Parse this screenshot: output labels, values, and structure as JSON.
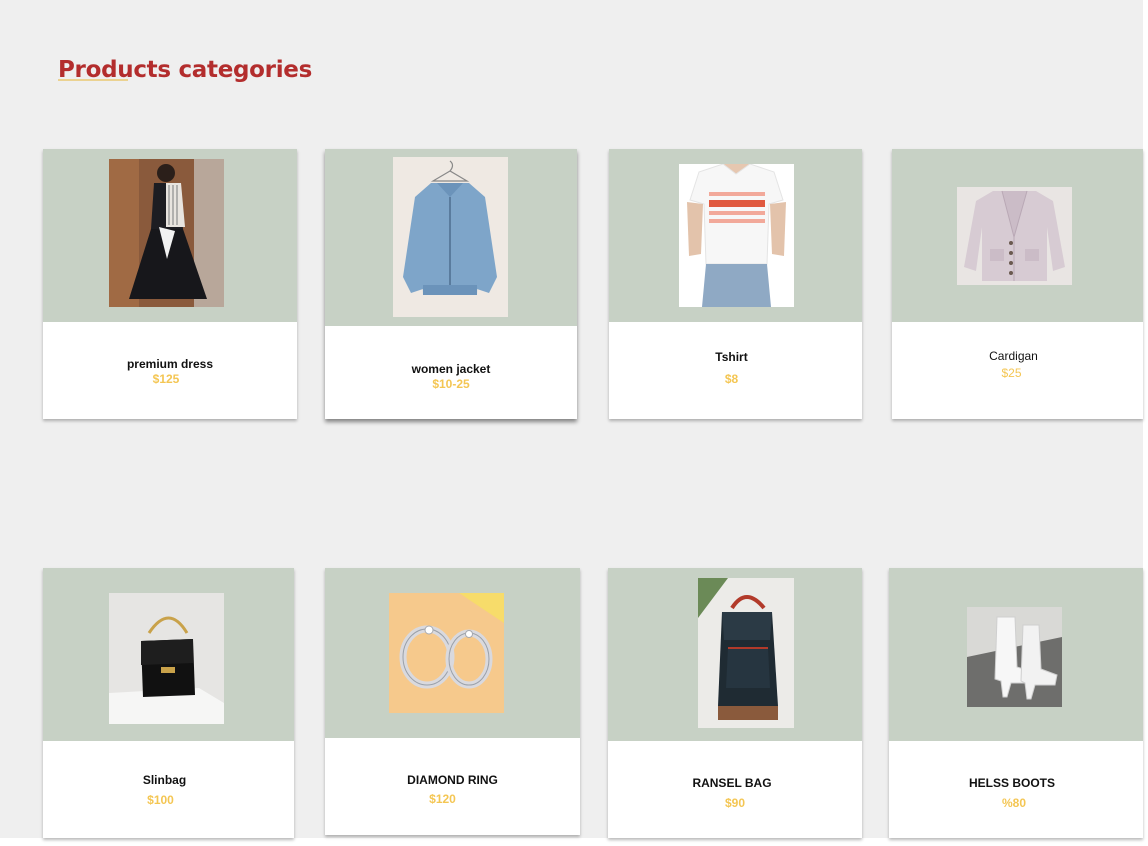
{
  "page": {
    "title": "Products categories",
    "colors": {
      "title": "#b32d2d",
      "price": "#f4c653",
      "image_bg": "#c7d1c5",
      "page_bg": "#efefef"
    }
  },
  "products": [
    {
      "name": "premium dress",
      "price": "$125",
      "image": "black-dress-photo"
    },
    {
      "name": "women jacket",
      "price": "$10-25",
      "image": "denim-jacket-photo"
    },
    {
      "name": "Tshirt",
      "price": "$8",
      "image": "white-tshirt-photo"
    },
    {
      "name": "Cardigan",
      "price": "$25",
      "image": "cardigan-photo"
    },
    {
      "name": "Slinbag",
      "price": "$100",
      "image": "black-sling-bag-photo"
    },
    {
      "name": "DIAMOND RING",
      "price": "$120",
      "image": "diamond-rings-photo"
    },
    {
      "name": "RANSEL BAG",
      "price": "$90",
      "image": "backpack-photo"
    },
    {
      "name": "HELSS BOOTS",
      "price": "%80",
      "image": "white-boots-photo"
    }
  ]
}
